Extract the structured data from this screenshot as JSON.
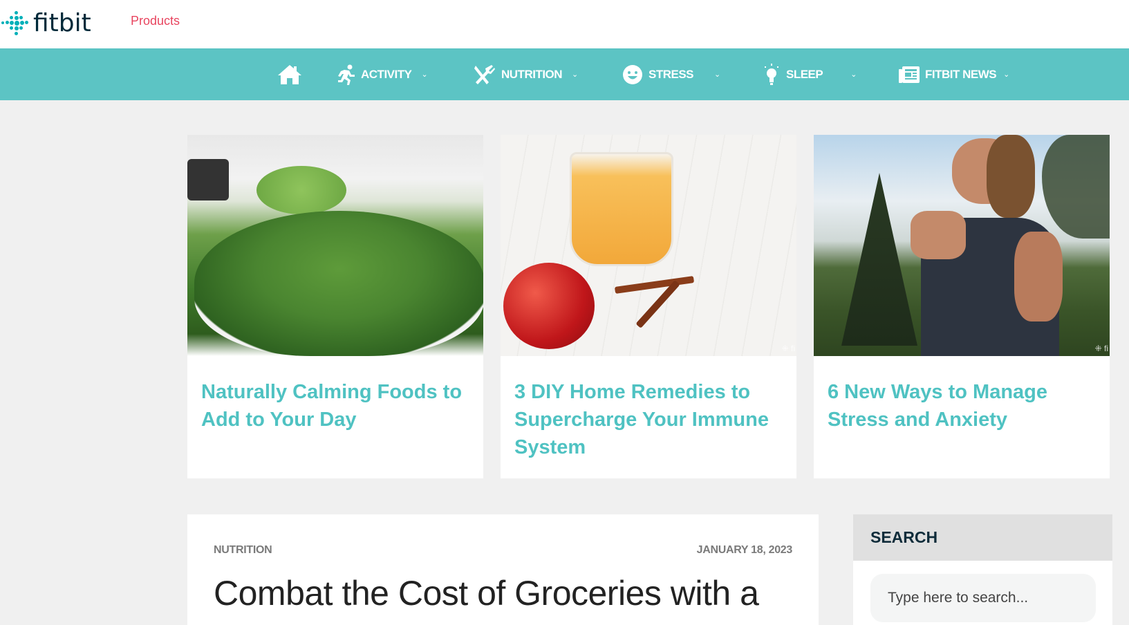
{
  "header": {
    "logo_text": "fitbit",
    "products_link": "Products"
  },
  "nav": {
    "items": [
      {
        "label": "",
        "icon": "home-icon"
      },
      {
        "label": "ACTIVITY",
        "icon": "running-icon",
        "dropdown": true
      },
      {
        "label": "NUTRITION",
        "icon": "utensils-icon",
        "dropdown": true
      },
      {
        "label": "STRESS",
        "icon": "smiley-icon",
        "dropdown": true
      },
      {
        "label": "SLEEP",
        "icon": "lightbulb-icon",
        "dropdown": true
      },
      {
        "label": "FITBIT NEWS",
        "icon": "newspaper-icon",
        "dropdown": true
      }
    ],
    "chevron": "⌄"
  },
  "featured": [
    {
      "title": "Naturally Calming Foods to Add to Your Day",
      "image": "spinach leaves in bowl"
    },
    {
      "title": "3 DIY Home Remedies to Supercharge Your Immune System",
      "image": "smoothie glass with apple and cinnamon",
      "watermark": "⁜ fi"
    },
    {
      "title": "6 New Ways to Manage Stress and Anxiety",
      "image": "woman with hands together outdoors",
      "watermark": "⁜ fi"
    }
  ],
  "article": {
    "category": "NUTRITION",
    "date": "JANUARY 18, 2023",
    "headline": "Combat the Cost of Groceries with a"
  },
  "sidebar": {
    "search": {
      "title": "SEARCH",
      "placeholder": "Type here to search..."
    }
  },
  "colors": {
    "nav_bg": "#5cc4c4",
    "accent": "#4fc2c2",
    "products_link": "#e8455f",
    "logo_dots": "#00b0b9"
  }
}
